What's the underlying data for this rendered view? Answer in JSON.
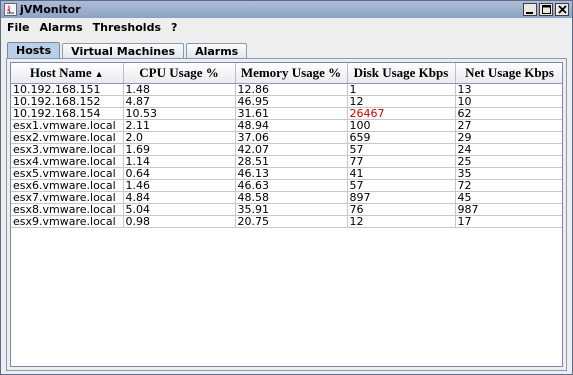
{
  "window": {
    "title": "jVMonitor"
  },
  "menubar": {
    "items": [
      "File",
      "Alarms",
      "Thresholds",
      "?"
    ]
  },
  "tabs": [
    {
      "label": "Hosts",
      "active": true
    },
    {
      "label": "Virtual Machines",
      "active": false
    },
    {
      "label": "Alarms",
      "active": false
    }
  ],
  "table": {
    "columns": [
      "Host Name",
      "CPU Usage %",
      "Memory Usage %",
      "Disk Usage Kbps",
      "Net Usage Kbps"
    ],
    "sort_column": "Host Name",
    "sort_direction": "ascending",
    "alarm_color": "#cc0000",
    "rows": [
      [
        "10.192.168.151",
        "1.48",
        "12.86",
        "1",
        "13"
      ],
      [
        "10.192.168.152",
        "4.87",
        "46.95",
        "12",
        "10"
      ],
      [
        "10.192.168.154",
        "10.53",
        "31.61",
        "26467",
        "62"
      ],
      [
        "esx1.vmware.local",
        "2.11",
        "48.94",
        "100",
        "27"
      ],
      [
        "esx2.vmware.local",
        "2.0",
        "37.06",
        "659",
        "29"
      ],
      [
        "esx3.vmware.local",
        "1.69",
        "42.07",
        "57",
        "24"
      ],
      [
        "esx4.vmware.local",
        "1.14",
        "28.51",
        "77",
        "25"
      ],
      [
        "esx5.vmware.local",
        "0.64",
        "46.13",
        "41",
        "35"
      ],
      [
        "esx6.vmware.local",
        "1.46",
        "46.63",
        "57",
        "72"
      ],
      [
        "esx7.vmware.local",
        "4.84",
        "48.58",
        "897",
        "45"
      ],
      [
        "esx8.vmware.local",
        "5.04",
        "35.91",
        "76",
        "987"
      ],
      [
        "esx9.vmware.local",
        "0.98",
        "20.75",
        "12",
        "17"
      ]
    ],
    "alarm_cells": [
      [
        2,
        3
      ]
    ]
  }
}
